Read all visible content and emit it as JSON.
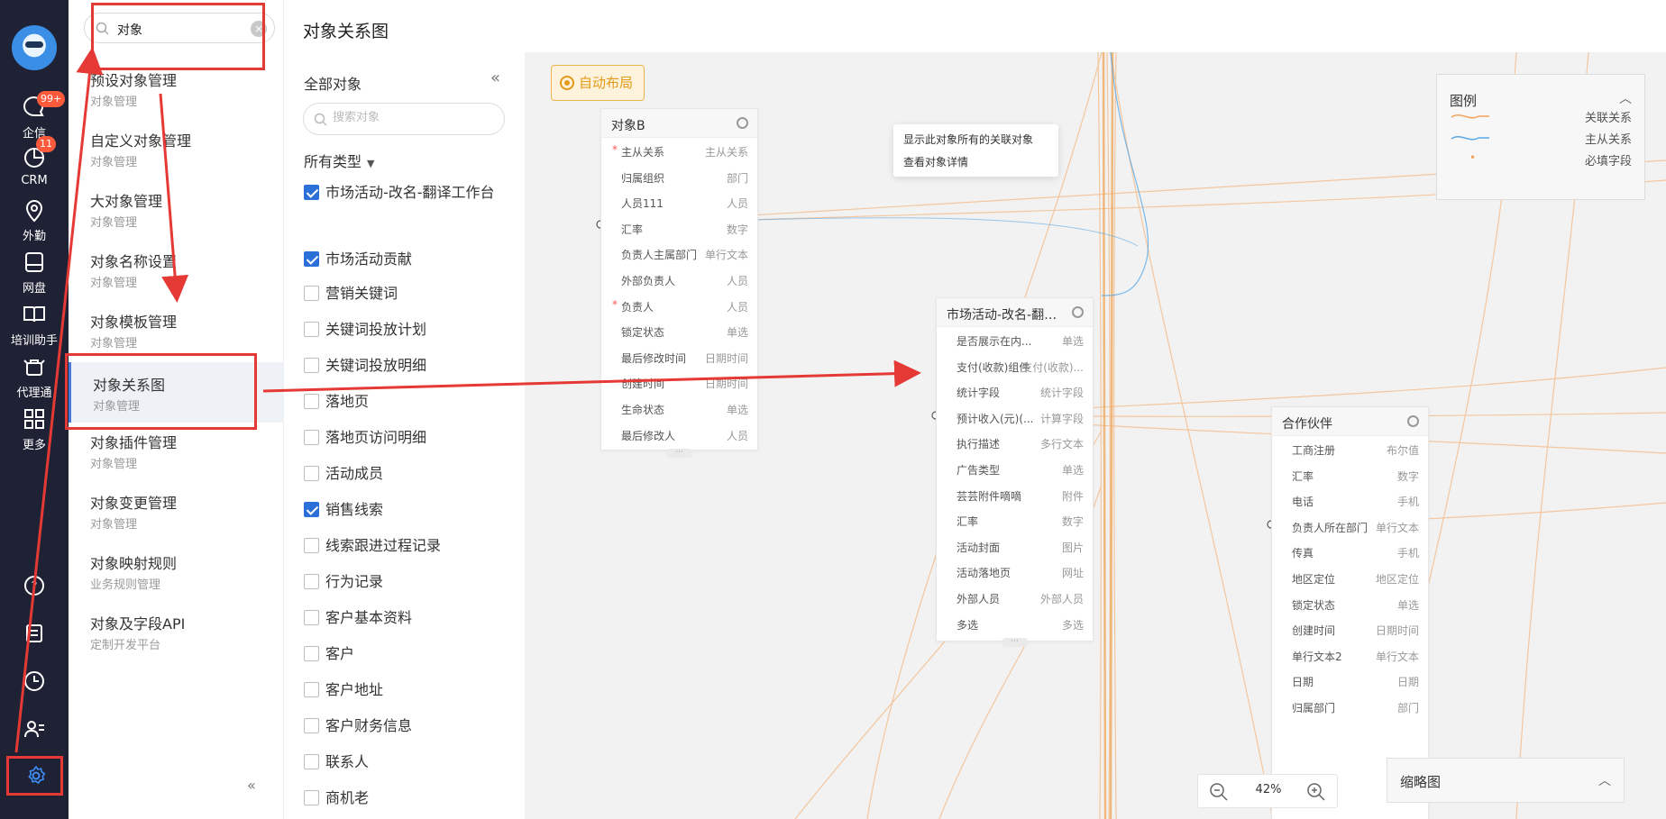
{
  "rail": {
    "items": [
      {
        "label": "企信",
        "icon": "chat-icon",
        "badge": "99+"
      },
      {
        "label": "CRM",
        "icon": "pie-chart-icon",
        "badge": "11"
      },
      {
        "label": "外勤",
        "icon": "location-icon",
        "badge": ""
      },
      {
        "label": "网盘",
        "icon": "disk-icon",
        "badge": ""
      },
      {
        "label": "培训助手",
        "icon": "book-icon",
        "badge": ""
      },
      {
        "label": "代理通",
        "icon": "agent-icon",
        "badge": ""
      },
      {
        "label": "更多",
        "icon": "grid-icon",
        "badge": ""
      }
    ],
    "bottom_icons": [
      "help-icon",
      "notes-icon",
      "clock-icon",
      "contacts-icon",
      "settings-gear-icon"
    ]
  },
  "menu": {
    "search_value": "对象",
    "items": [
      {
        "title": "预设对象管理",
        "sub": "对象管理"
      },
      {
        "title": "自定义对象管理",
        "sub": "对象管理"
      },
      {
        "title": "大对象管理",
        "sub": "对象管理"
      },
      {
        "title": "对象名称设置",
        "sub": "对象管理"
      },
      {
        "title": "对象模板管理",
        "sub": "对象管理"
      },
      {
        "title": "对象关系图",
        "sub": "对象管理"
      },
      {
        "title": "对象插件管理",
        "sub": "对象管理"
      },
      {
        "title": "对象变更管理",
        "sub": "对象管理"
      },
      {
        "title": "对象映射规则",
        "sub": "业务规则管理"
      },
      {
        "title": "对象及字段API",
        "sub": "定制开发平台"
      }
    ],
    "collapse": "«"
  },
  "page_title": "对象关系图",
  "objlist": {
    "header": "全部对象",
    "collapse": "«",
    "search_placeholder": "搜索对象",
    "type_filter": "所有类型",
    "items": [
      {
        "label": "市场活动-改名-翻译工作台",
        "checked": true
      },
      {
        "label": "市场活动贡献",
        "checked": true
      },
      {
        "label": "营销关键词",
        "checked": false
      },
      {
        "label": "关键词投放计划",
        "checked": false
      },
      {
        "label": "关键词投放明细",
        "checked": false
      },
      {
        "label": "落地页",
        "checked": false
      },
      {
        "label": "落地页访问明细",
        "checked": false
      },
      {
        "label": "活动成员",
        "checked": false
      },
      {
        "label": "销售线索",
        "checked": true
      },
      {
        "label": "线索跟进过程记录",
        "checked": false
      },
      {
        "label": "行为记录",
        "checked": false
      },
      {
        "label": "客户基本资料",
        "checked": false
      },
      {
        "label": "客户",
        "checked": false
      },
      {
        "label": "客户地址",
        "checked": false
      },
      {
        "label": "客户财务信息",
        "checked": false
      },
      {
        "label": "联系人",
        "checked": false
      },
      {
        "label": "商机老",
        "checked": false
      }
    ]
  },
  "canvas": {
    "auto_layout": "自动布局",
    "context_menu": [
      "显示此对象所有的关联对象",
      "查看对象详情"
    ],
    "nodes": [
      {
        "name": "对象B",
        "fields": [
          {
            "label": "主从关系",
            "type": "主从关系",
            "required": true
          },
          {
            "label": "归属组织",
            "type": "部门",
            "required": false
          },
          {
            "label": "人员111",
            "type": "人员",
            "required": false
          },
          {
            "label": "汇率",
            "type": "数字",
            "required": false
          },
          {
            "label": "负责人主属部门",
            "type": "单行文本",
            "required": false
          },
          {
            "label": "外部负责人",
            "type": "人员",
            "required": false
          },
          {
            "label": "负责人",
            "type": "人员",
            "required": true
          },
          {
            "label": "锁定状态",
            "type": "单选",
            "required": false
          },
          {
            "label": "最后修改时间",
            "type": "日期时间",
            "required": false
          },
          {
            "label": "创建时间",
            "type": "日期时间",
            "required": false
          },
          {
            "label": "生命状态",
            "type": "单选",
            "required": false
          },
          {
            "label": "最后修改人",
            "type": "人员",
            "required": false
          }
        ]
      },
      {
        "name": "市场活动-改名-翻译工...",
        "fields": [
          {
            "label": "是否展示在内...",
            "type": "单选",
            "required": false
          },
          {
            "label": "支付(收款)组件",
            "type": "支付(收款)...",
            "required": false
          },
          {
            "label": "统计字段",
            "type": "统计字段",
            "required": false
          },
          {
            "label": "预计收入(元)(...",
            "type": "计算字段",
            "required": false
          },
          {
            "label": "执行描述",
            "type": "多行文本",
            "required": false
          },
          {
            "label": "广告类型",
            "type": "单选",
            "required": false
          },
          {
            "label": "芸芸附件嘀嘀",
            "type": "附件",
            "required": false
          },
          {
            "label": "汇率",
            "type": "数字",
            "required": false
          },
          {
            "label": "活动封面",
            "type": "图片",
            "required": false
          },
          {
            "label": "活动落地页",
            "type": "网址",
            "required": false
          },
          {
            "label": "外部人员",
            "type": "外部人员",
            "required": false
          },
          {
            "label": "多选",
            "type": "多选",
            "required": false
          }
        ]
      },
      {
        "name": "合作伙伴",
        "fields": [
          {
            "label": "工商注册",
            "type": "布尔值",
            "required": false
          },
          {
            "label": "汇率",
            "type": "数字",
            "required": false
          },
          {
            "label": "电话",
            "type": "手机",
            "required": false
          },
          {
            "label": "负责人所在部门",
            "type": "单行文本",
            "required": false
          },
          {
            "label": "传真",
            "type": "手机",
            "required": false
          },
          {
            "label": "地区定位",
            "type": "地区定位",
            "required": false
          },
          {
            "label": "锁定状态",
            "type": "单选",
            "required": false
          },
          {
            "label": "创建时间",
            "type": "日期时间",
            "required": false
          },
          {
            "label": "单行文本2",
            "type": "单行文本",
            "required": false
          },
          {
            "label": "日期",
            "type": "日期",
            "required": false
          },
          {
            "label": "归属部门",
            "type": "部门",
            "required": false
          }
        ]
      }
    ],
    "legend": {
      "title": "图例",
      "items": [
        {
          "label": "关联关系",
          "color": "#f5a35b",
          "kind": "line"
        },
        {
          "label": "主从关系",
          "color": "#5aa9e6",
          "kind": "line"
        },
        {
          "label": "必填字段",
          "color": "#f5a35b",
          "kind": "dot"
        }
      ]
    },
    "zoom": {
      "value": "42%"
    },
    "minimap": {
      "title": "缩略图"
    }
  },
  "colors": {
    "accent": "#2b6fd8",
    "annotation": "#e53935",
    "relation": "#f5a35b",
    "master_detail": "#5aa9e6"
  }
}
